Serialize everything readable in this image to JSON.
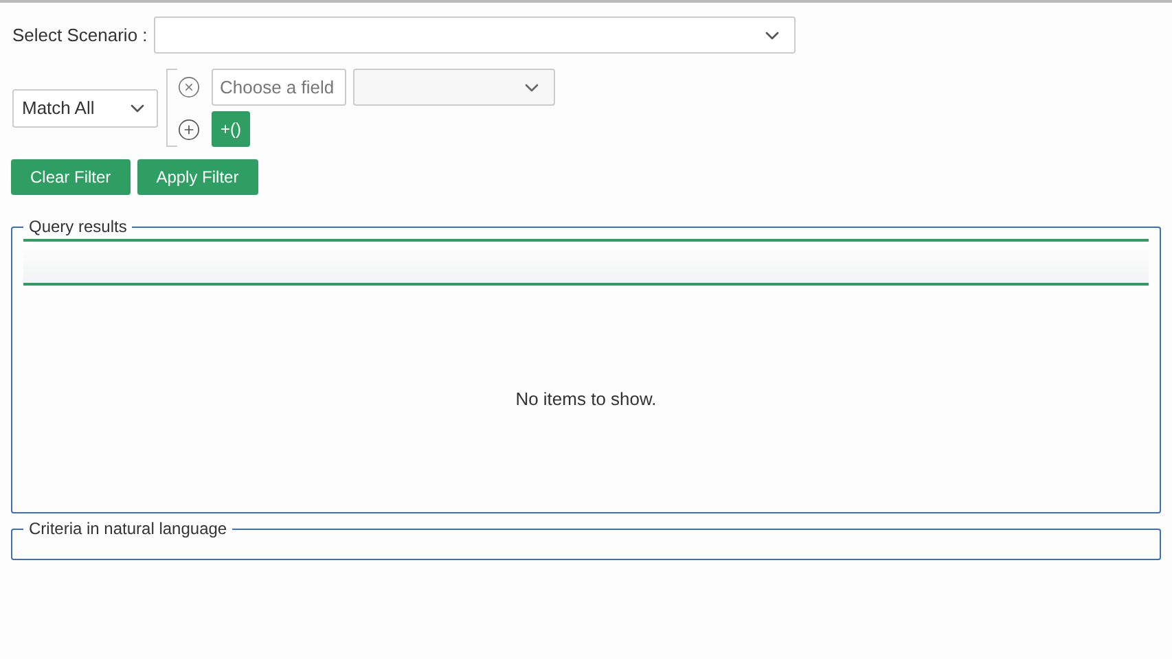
{
  "scenario": {
    "label": "Select Scenario :"
  },
  "filter": {
    "match": "Match All",
    "field_placeholder": "Choose a field",
    "group_button": "+()"
  },
  "buttons": [
    "Clear Filter",
    "Apply Filter"
  ],
  "query_results": {
    "legend": "Query results",
    "empty_text": "No items to show."
  },
  "criteria": {
    "legend": "Criteria in natural language"
  }
}
